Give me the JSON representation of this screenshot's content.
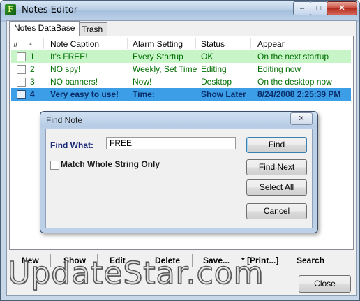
{
  "window": {
    "title": "Notes Editor",
    "icon": "notes-app-icon",
    "controls": {
      "minimize": "–",
      "maximize": "□",
      "close": "✕"
    }
  },
  "tabs": [
    {
      "label": "Notes DataBase",
      "active": true
    },
    {
      "label": "Trash",
      "active": false
    }
  ],
  "grid": {
    "columns": [
      "#",
      "Note Caption",
      "Alarm Setting",
      "Status",
      "Appear"
    ],
    "sort_indicator": "▲",
    "rows": [
      {
        "num": "1",
        "caption": "It's FREE!",
        "alarm": "Every Startup",
        "status": "OK",
        "appear": "On the next startup"
      },
      {
        "num": "2",
        "caption": "NO spy!",
        "alarm": "Weekly, Set Time",
        "status": "Editing",
        "appear": "Editing now"
      },
      {
        "num": "3",
        "caption": "NO banners!",
        "alarm": "Now!",
        "status": "Desktop",
        "appear": "On the desktop now"
      },
      {
        "num": "4",
        "caption": "Very easy to use!",
        "alarm": "Time:",
        "status": "Show Later",
        "appear": "8/24/2008 2:25:39 PM"
      }
    ]
  },
  "find_dialog": {
    "title": "Find Note",
    "close": "✕",
    "find_label": "Find What:",
    "find_value": "FREE",
    "match_label": "Match Whole String Only",
    "buttons": {
      "find": "Find",
      "find_next": "Find Next",
      "select_all": "Select All",
      "cancel": "Cancel"
    }
  },
  "toolbar": {
    "new": "New",
    "show": "Show",
    "edit": "Edit",
    "delete": "Delete",
    "save": "Save...",
    "print": "* [Print...]",
    "search": "Search"
  },
  "close_button": "Close",
  "watermark": "UpdateStar.com",
  "colors": {
    "row_highlight": "#c8f5c8",
    "row_text": "#006e00",
    "selected_row": "#3b9ee6"
  }
}
